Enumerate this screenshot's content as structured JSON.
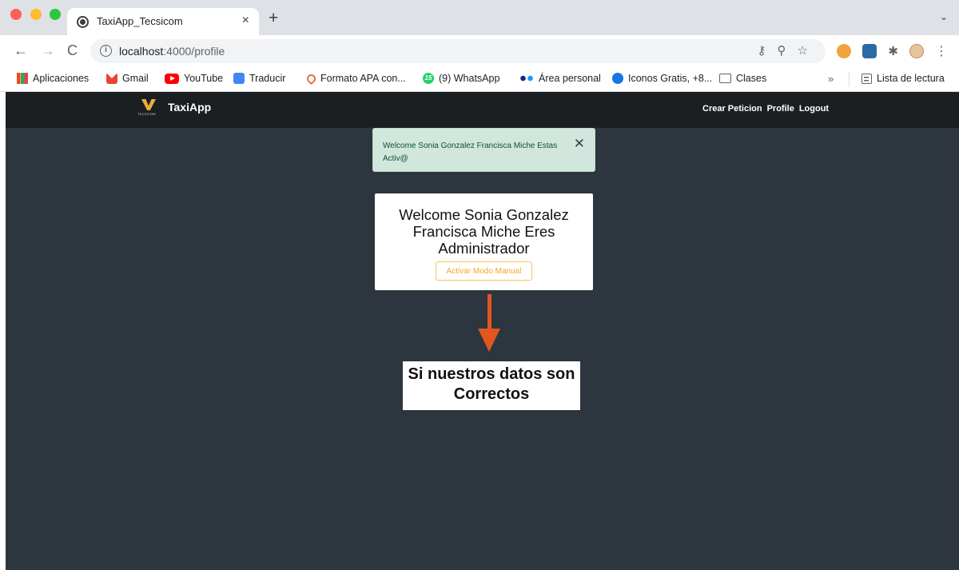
{
  "browser": {
    "tab": {
      "title": "TaxiApp_Tecsicom",
      "close": "×"
    },
    "new_tab": "+",
    "tab_menu": "⌄",
    "nav": {
      "back": "←",
      "forward": "→",
      "reload": "C"
    },
    "address": {
      "host": "localhost",
      "path": ":4000/profile"
    },
    "bookmarks": [
      {
        "label": "Aplicaciones",
        "icon": "apps-grid-icon"
      },
      {
        "label": "Gmail",
        "icon": "gmail-icon"
      },
      {
        "label": "YouTube",
        "icon": "youtube-icon"
      },
      {
        "label": "Traducir",
        "icon": "translate-icon"
      },
      {
        "label": "Formato APA con...",
        "icon": "apa-icon"
      },
      {
        "label": "(9) WhatsApp",
        "icon": "whatsapp-icon",
        "badge": "15"
      },
      {
        "label": "Área personal",
        "icon": "dots-icon"
      },
      {
        "label": "Iconos Gratis, +8...",
        "icon": "iconos-icon"
      },
      {
        "label": "Clases",
        "icon": "folder-icon"
      }
    ],
    "bookmarks_more": "»",
    "reading_list": "Lista de lectura"
  },
  "app": {
    "brand": {
      "name": "TaxiApp",
      "sub": "TECSICOM",
      "accent": "#e8b03a"
    },
    "nav": [
      {
        "label": "Crear Peticion"
      },
      {
        "label": "Profile"
      },
      {
        "label": "Logout"
      }
    ],
    "alert": {
      "message": "Welcome Sonia Gonzalez Francisca Miche Estas Activ@",
      "close": "✕"
    },
    "card": {
      "title": "Welcome Sonia Gonzalez Francisca Miche Eres Administrador",
      "button": "Activar Modo Manual"
    },
    "annotation": {
      "text": "Si nuestros datos son Correctos",
      "arrow_color": "#e2571f"
    }
  }
}
